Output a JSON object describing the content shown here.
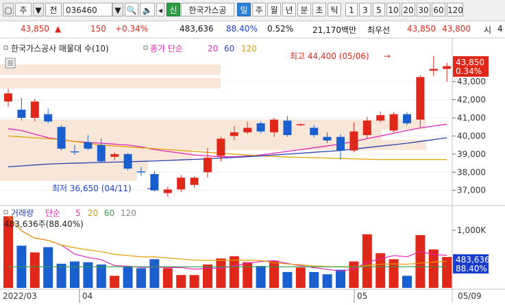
{
  "toolbar": {
    "type_label": "주",
    "tag_label": "전",
    "code": "036460",
    "stock_name": "한국가스공",
    "new_label": "신",
    "periods": [
      "일",
      "주",
      "월",
      "년",
      "분",
      "초",
      "틱"
    ],
    "active_period": "일",
    "intervals": [
      "1",
      "3",
      "5",
      "10",
      "20",
      "30",
      "60",
      "120"
    ]
  },
  "price_bar": {
    "price": "43,850",
    "change": "150",
    "change_pct": "+0.34%",
    "volume": "483,636",
    "ratio": "88.40%",
    "turnover": "0.52%",
    "amount": "21,170백만",
    "quote_label": "최우선",
    "ask": "43,850",
    "bid": "43,800",
    "open_label": "시",
    "open_value": "4"
  },
  "main_legend": {
    "title": "한국가스공사 매물대 수(10)",
    "ma_title": "종가 단순",
    "ma_periods": [
      "20",
      "60",
      "120"
    ]
  },
  "price_annotations": {
    "high": "최고 44,400 (05/06)",
    "low": "최저 36,650 (04/11)"
  },
  "current_price_tag": {
    "price": "43,850",
    "pct": "0.34%"
  },
  "volume_legend": {
    "title": "거래량",
    "ma_title": "단순",
    "ma_periods": [
      "5",
      "20",
      "60",
      "120"
    ],
    "current": "483,636주(88.40%)"
  },
  "volume_tag": {
    "value": "483,636",
    "pct": "88.40%"
  },
  "price_axis": {
    "ticks": [
      "43,000",
      "42,000",
      "41,000",
      "40,000",
      "39,000",
      "38,000",
      "37,000"
    ]
  },
  "volume_axis": {
    "ticks": [
      "1,000K"
    ]
  },
  "date_axis": {
    "labels": [
      "2022/03",
      "04",
      "05",
      "05/09"
    ]
  },
  "chart_data": {
    "type": "candlestick",
    "y_range": [
      36650,
      44400
    ],
    "candles": [
      {
        "o": 41900,
        "h": 42600,
        "l": 41600,
        "c": 42350
      },
      {
        "o": 41450,
        "h": 42100,
        "l": 40850,
        "c": 41000
      },
      {
        "o": 41000,
        "h": 42050,
        "l": 40800,
        "c": 41900
      },
      {
        "o": 41200,
        "h": 41500,
        "l": 40700,
        "c": 40800
      },
      {
        "o": 40500,
        "h": 40600,
        "l": 39200,
        "c": 39300
      },
      {
        "o": 39150,
        "h": 39500,
        "l": 38950,
        "c": 39100
      },
      {
        "o": 39650,
        "h": 40050,
        "l": 39200,
        "c": 39300
      },
      {
        "o": 39500,
        "h": 39850,
        "l": 38550,
        "c": 38600
      },
      {
        "o": 38850,
        "h": 39100,
        "l": 38650,
        "c": 39000
      },
      {
        "o": 39000,
        "h": 39050,
        "l": 38100,
        "c": 38200
      },
      {
        "o": 38050,
        "h": 38300,
        "l": 37800,
        "c": 38000
      },
      {
        "o": 37900,
        "h": 38050,
        "l": 36950,
        "c": 37000
      },
      {
        "o": 36850,
        "h": 37200,
        "l": 36650,
        "c": 37050
      },
      {
        "o": 37050,
        "h": 37850,
        "l": 36900,
        "c": 37700
      },
      {
        "o": 37300,
        "h": 37800,
        "l": 37150,
        "c": 37700
      },
      {
        "o": 38000,
        "h": 39350,
        "l": 37700,
        "c": 38800
      },
      {
        "o": 38900,
        "h": 39950,
        "l": 38600,
        "c": 39850
      },
      {
        "o": 40000,
        "h": 40550,
        "l": 39750,
        "c": 40200
      },
      {
        "o": 40200,
        "h": 40800,
        "l": 40100,
        "c": 40450
      },
      {
        "o": 40700,
        "h": 40800,
        "l": 40150,
        "c": 40250
      },
      {
        "o": 40200,
        "h": 41000,
        "l": 39950,
        "c": 40900
      },
      {
        "o": 40850,
        "h": 41100,
        "l": 39950,
        "c": 40050
      },
      {
        "o": 40600,
        "h": 40700,
        "l": 40550,
        "c": 40650
      },
      {
        "o": 40450,
        "h": 40600,
        "l": 39900,
        "c": 40050
      },
      {
        "o": 39950,
        "h": 40200,
        "l": 39600,
        "c": 39750
      },
      {
        "o": 39950,
        "h": 40100,
        "l": 38700,
        "c": 39200
      },
      {
        "o": 39200,
        "h": 40750,
        "l": 39100,
        "c": 40250
      },
      {
        "o": 40050,
        "h": 41050,
        "l": 39850,
        "c": 40850
      },
      {
        "o": 40850,
        "h": 41350,
        "l": 40750,
        "c": 41150
      },
      {
        "o": 40300,
        "h": 41300,
        "l": 40200,
        "c": 41200
      },
      {
        "o": 41200,
        "h": 41300,
        "l": 40600,
        "c": 40700
      },
      {
        "o": 40900,
        "h": 43350,
        "l": 40500,
        "c": 43250
      },
      {
        "o": 43600,
        "h": 44400,
        "l": 43300,
        "c": 43700
      },
      {
        "o": 43700,
        "h": 44050,
        "l": 43000,
        "c": 43850
      }
    ],
    "volume_ratio": [
      0.95,
      0.56,
      0.47,
      0.54,
      0.32,
      0.35,
      0.34,
      0.31,
      0.16,
      0.28,
      0.26,
      0.38,
      0.26,
      0.17,
      0.17,
      0.31,
      0.39,
      0.42,
      0.34,
      0.29,
      0.36,
      0.21,
      0.27,
      0.21,
      0.18,
      0.24,
      0.35,
      0.71,
      0.46,
      0.38,
      0.16,
      0.7,
      0.51,
      0.41
    ],
    "ma20": [
      40400,
      40300,
      40100,
      39900,
      39800,
      39700,
      39650,
      39600,
      39550,
      39500,
      39400,
      39250,
      39150,
      39050,
      38950,
      38900,
      38850,
      38850,
      38900,
      38950,
      39050,
      39150,
      39250,
      39350,
      39450,
      39550,
      39700,
      39850,
      40000,
      40150,
      40300,
      40450,
      40550,
      40650
    ],
    "ma60": [
      40000,
      39950,
      39900,
      39850,
      39800,
      39700,
      39600,
      39500,
      39450,
      39400,
      39350,
      39300,
      39250,
      39200,
      39150,
      39100,
      39050,
      39000,
      38950,
      38900,
      38870,
      38840,
      38820,
      38800,
      38780,
      38760,
      38740,
      38720,
      38700,
      38700,
      38700,
      38700,
      38700,
      38700
    ],
    "ma120": [
      38300,
      38350,
      38400,
      38450,
      38480,
      38500,
      38520,
      38540,
      38560,
      38580,
      38600,
      38620,
      38650,
      38680,
      38710,
      38740,
      38780,
      38820,
      38860,
      38900,
      38950,
      39000,
      39050,
      39100,
      39150,
      39200,
      39280,
      39360,
      39440,
      39520,
      39600,
      39700,
      39800,
      39900
    ]
  }
}
